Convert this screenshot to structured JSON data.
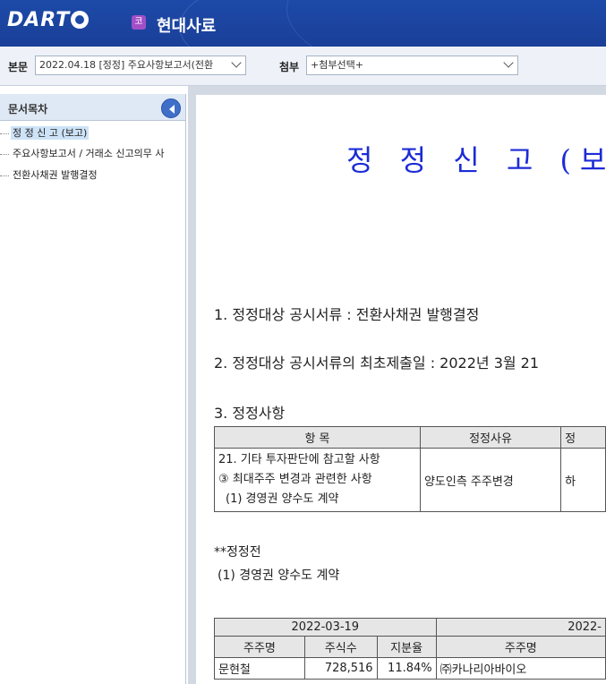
{
  "header": {
    "logo_text": "DART",
    "company_badge": "코",
    "company_name": "현대사료"
  },
  "toolbar": {
    "body_label": "본문",
    "body_select": "2022.04.18 [정정] 주요사항보고서(전환",
    "attach_label": "첨부",
    "attach_select": "+첨부선택+"
  },
  "toc": {
    "title": "문서목차",
    "items": [
      {
        "label": "정 정 신 고 (보고)",
        "active": true
      },
      {
        "label": "주요사항보고서 / 거래소 신고의무 사",
        "active": false
      },
      {
        "label": "전환사채권 발행결정",
        "active": false
      }
    ]
  },
  "document": {
    "title": "정 정 신 고 (보고",
    "item1": "1. 정정대상 공시서류 : 전환사채권 발행결정",
    "item2": "2. 정정대상 공시서류의 최초제출일 : 2022년 3월 21",
    "item3": "3. 정정사항",
    "table1": {
      "headers": [
        "항 목",
        "정정사유",
        "정"
      ],
      "row": {
        "item_lines": [
          "21. 기타 투자판단에 참고할 사항",
          "③ 최대주주 변경과 관련한 사항",
          "(1) 경영권 양수도 계약"
        ],
        "reason": "양도인측 주주변경",
        "third": "하"
      }
    },
    "before_label": "**정정전",
    "before_sub": "(1) 경영권 양수도 계약",
    "table2": {
      "date1": "2022-03-19",
      "date2": "2022-",
      "headers": [
        "주주명",
        "주식수",
        "지분율",
        "주주명"
      ],
      "row": [
        "문현철",
        "728,516",
        "11.84%",
        "㈜카나리아바이오"
      ]
    }
  }
}
